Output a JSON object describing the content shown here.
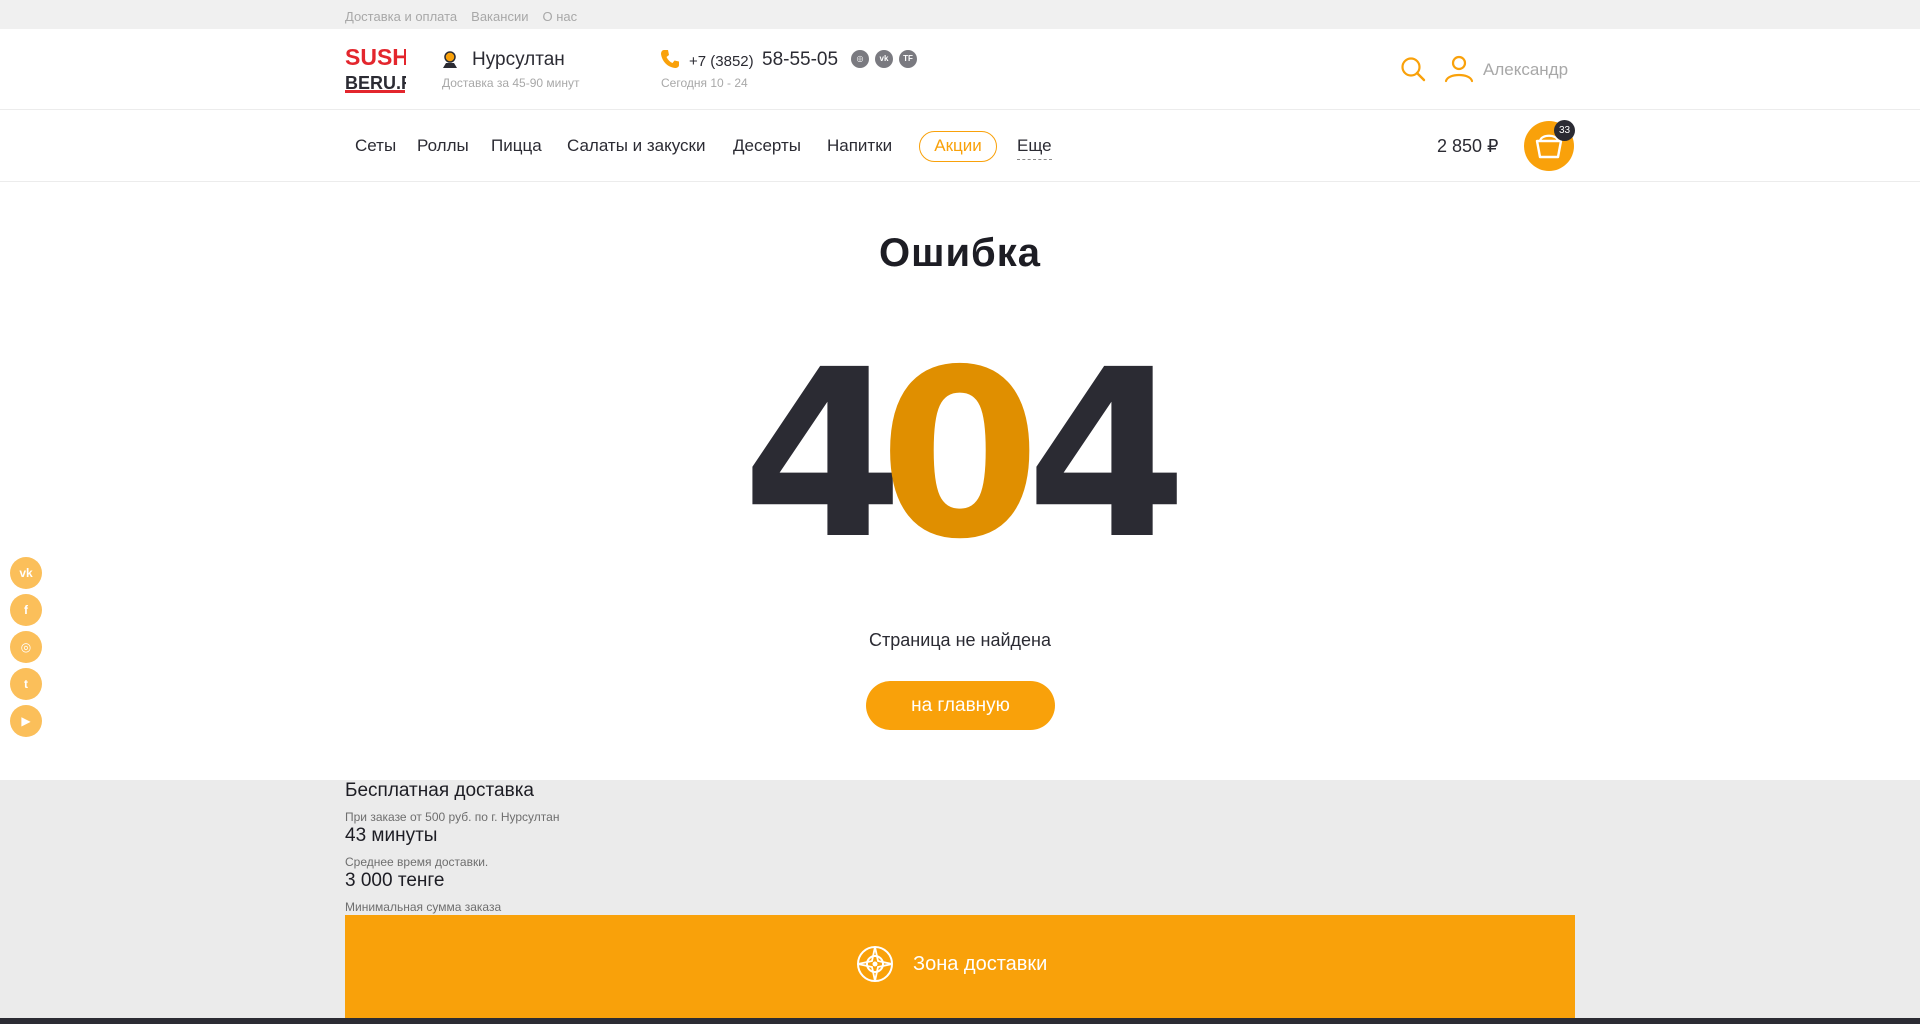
{
  "topbar": {
    "links": [
      "Доставка и оплата",
      "Вакансии",
      "О нас"
    ]
  },
  "header": {
    "logo_line1": "SUSHI",
    "logo_line2": "BERU.RU",
    "city": "Нурсултан",
    "delivery_time": "Доставка за 45-90 минут",
    "phone_prefix": "+7 (3852)",
    "phone_number": "58-55-05",
    "hours": "Сегодня 10 - 24",
    "social_small": [
      "instagram-icon",
      "vk-icon",
      "tf-icon"
    ],
    "username": "Александр"
  },
  "nav": {
    "items": [
      "Сеты",
      "Роллы",
      "Пицца",
      "Салаты и закуски",
      "Десерты",
      "Напитки"
    ],
    "promo": "Акции",
    "more": "Еще",
    "cart_sum": "2 850 ₽",
    "cart_count": "33"
  },
  "main": {
    "title": "Ошибка",
    "code_digits": [
      "4",
      "0",
      "4"
    ],
    "message": "Страница не найдена",
    "home_button": "на главную"
  },
  "side_social": [
    "vk-icon",
    "facebook-icon",
    "instagram-icon",
    "twitter-icon",
    "youtube-icon"
  ],
  "info": {
    "free_delivery_title": "Бесплатная доставка",
    "free_delivery_sub": "При заказе от 500 руб. по г. Нурсултан",
    "avg_time_title": "43 минуты",
    "avg_time_sub": "Среднее время доставки.",
    "min_sum_title": "3 000 тенге",
    "min_sum_sub": "Минимальная сумма заказа",
    "zone_label": "Зона доставки"
  },
  "colors": {
    "accent": "#f9a10a",
    "dark": "#2b2b33",
    "accent_dark": "#e08f00"
  }
}
